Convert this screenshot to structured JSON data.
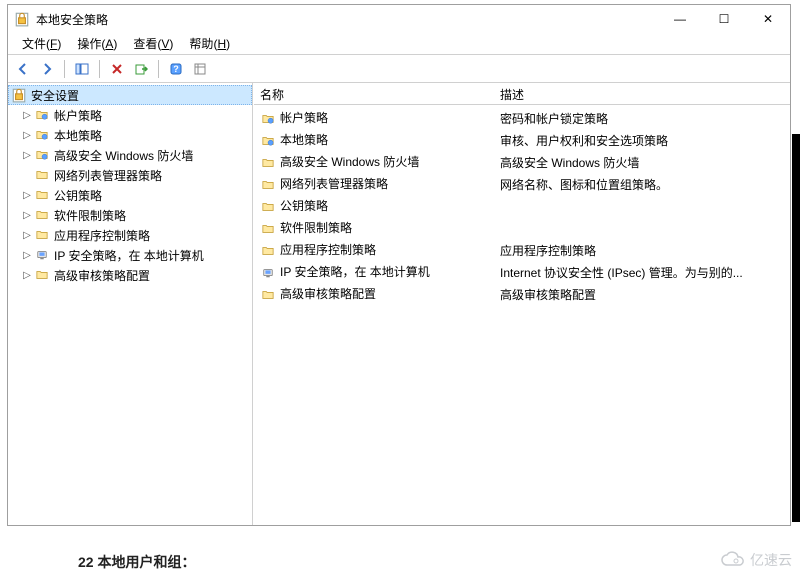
{
  "window": {
    "title": "本地安全策略",
    "controls": {
      "min": "—",
      "max": "☐",
      "close": "✕"
    }
  },
  "menubar": {
    "file": {
      "label": "文件",
      "mn": "F"
    },
    "action": {
      "label": "操作",
      "mn": "A"
    },
    "view": {
      "label": "查看",
      "mn": "V"
    },
    "help": {
      "label": "帮助",
      "mn": "H"
    }
  },
  "tree": {
    "root": "安全设置",
    "items": [
      {
        "label": "帐户策略",
        "icon": "policy",
        "expandable": true
      },
      {
        "label": "本地策略",
        "icon": "policy",
        "expandable": true
      },
      {
        "label": "高级安全 Windows 防火墙",
        "icon": "policy",
        "expandable": true
      },
      {
        "label": "网络列表管理器策略",
        "icon": "folder",
        "expandable": false
      },
      {
        "label": "公钥策略",
        "icon": "folder",
        "expandable": true
      },
      {
        "label": "软件限制策略",
        "icon": "folder",
        "expandable": true
      },
      {
        "label": "应用程序控制策略",
        "icon": "folder",
        "expandable": true
      },
      {
        "label": "IP 安全策略，在 本地计算机",
        "icon": "ipsec",
        "expandable": true
      },
      {
        "label": "高级审核策略配置",
        "icon": "folder",
        "expandable": true
      }
    ]
  },
  "list": {
    "headers": {
      "name": "名称",
      "desc": "描述"
    },
    "rows": [
      {
        "name": "帐户策略",
        "desc": "密码和帐户锁定策略",
        "icon": "policy"
      },
      {
        "name": "本地策略",
        "desc": "审核、用户权利和安全选项策略",
        "icon": "policy"
      },
      {
        "name": "高级安全 Windows 防火墙",
        "desc": "高级安全 Windows 防火墙",
        "icon": "folder"
      },
      {
        "name": "网络列表管理器策略",
        "desc": "网络名称、图标和位置组策略。",
        "icon": "folder"
      },
      {
        "name": "公钥策略",
        "desc": "",
        "icon": "folder"
      },
      {
        "name": "软件限制策略",
        "desc": "",
        "icon": "folder"
      },
      {
        "name": "应用程序控制策略",
        "desc": "应用程序控制策略",
        "icon": "folder"
      },
      {
        "name": "IP 安全策略，在 本地计算机",
        "desc": "Internet 协议安全性 (IPsec) 管理。为与别的...",
        "icon": "ipsec"
      },
      {
        "name": "高级审核策略配置",
        "desc": "高级审核策略配置",
        "icon": "folder"
      }
    ]
  },
  "watermark": "亿速云",
  "partial_text": "22  本地用户和组："
}
